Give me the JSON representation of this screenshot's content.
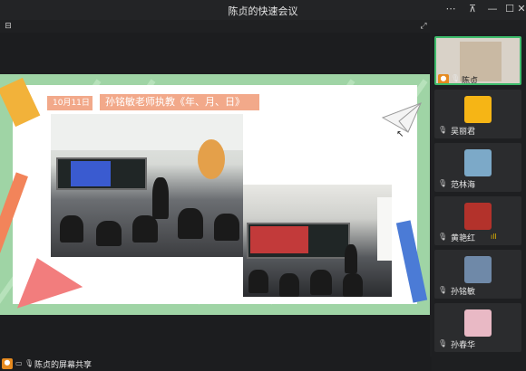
{
  "window": {
    "title": "陈贞的快速会议",
    "controls": {
      "more": "⋯",
      "pin": "⊼",
      "minimize": "—",
      "maximize": "☐",
      "close": "✕"
    }
  },
  "toolbar": {
    "left_icon": "⊟",
    "right_icon": "⤢"
  },
  "share": {
    "date_tag": "10月11日",
    "caption": "孙铭敏老师执教《年、月、日》"
  },
  "participants": [
    {
      "name": "陈贞",
      "role": "host",
      "avatar_color": "#c9b9a3"
    },
    {
      "name": "吴丽君",
      "avatar_color": "#f6b515"
    },
    {
      "name": "范林海",
      "avatar_color": "#7ca9c8"
    },
    {
      "name": "黄艳红",
      "avatar_color": "#b3322b",
      "signal": "ıll"
    },
    {
      "name": "孙铭敏",
      "avatar_color": "#6f89a8"
    },
    {
      "name": "孙春华",
      "avatar_color": "#e9b9c5"
    }
  ],
  "statusbar": {
    "label": "陈贞的屏幕共享"
  },
  "icons": {
    "host": "host-icon",
    "mic": "microphone-icon",
    "screen": "screen-share-icon"
  },
  "colors": {
    "active_border": "#3dbb6b",
    "host_badge": "#e68a1f",
    "slide_green": "#9fd4a5",
    "caption_bg": "#f2a98a"
  }
}
